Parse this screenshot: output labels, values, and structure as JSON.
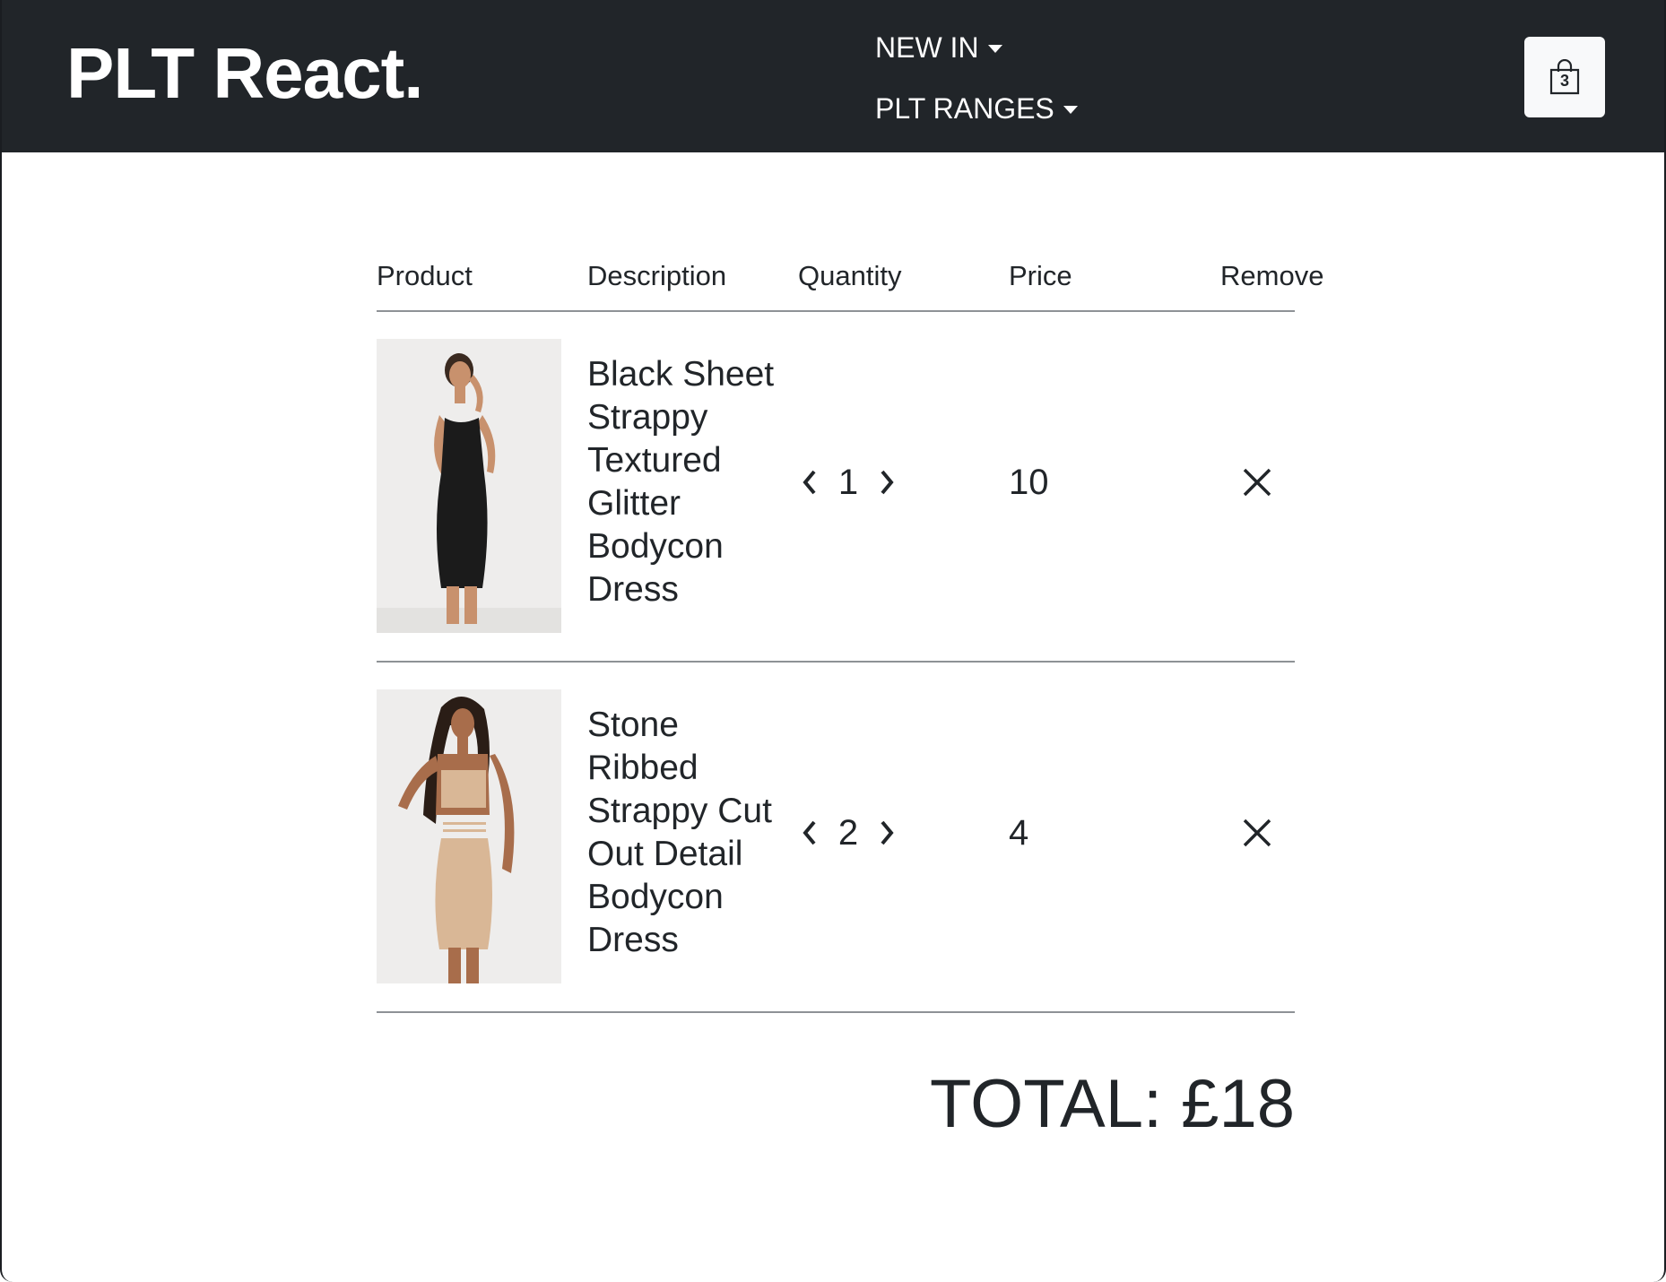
{
  "navbar": {
    "brand": "PLT React.",
    "menu": [
      {
        "label": "NEW IN"
      },
      {
        "label": "PLT RANGES"
      }
    ],
    "cart": {
      "count": "3",
      "icon": "shopping-bag-icon"
    }
  },
  "table": {
    "headers": {
      "product": "Product",
      "description": "Description",
      "quantity": "Quantity",
      "price": "Price",
      "remove": "Remove"
    },
    "rows": [
      {
        "description": "Black Sheet Strappy Textured Glitter Bodycon Dress",
        "quantity": "1",
        "price": "10",
        "dress_color": "#1b1b1b"
      },
      {
        "description": "Stone Ribbed Strappy Cut Out Detail Bodycon Dress",
        "quantity": "2",
        "price": "4",
        "dress_color": "#d9b796"
      }
    ]
  },
  "total": {
    "label": "TOTAL: £18"
  },
  "colors": {
    "navbar_bg": "#212529",
    "text": "#212529",
    "divider": "#8e9296",
    "cart_button_bg": "#f8f9fa"
  }
}
